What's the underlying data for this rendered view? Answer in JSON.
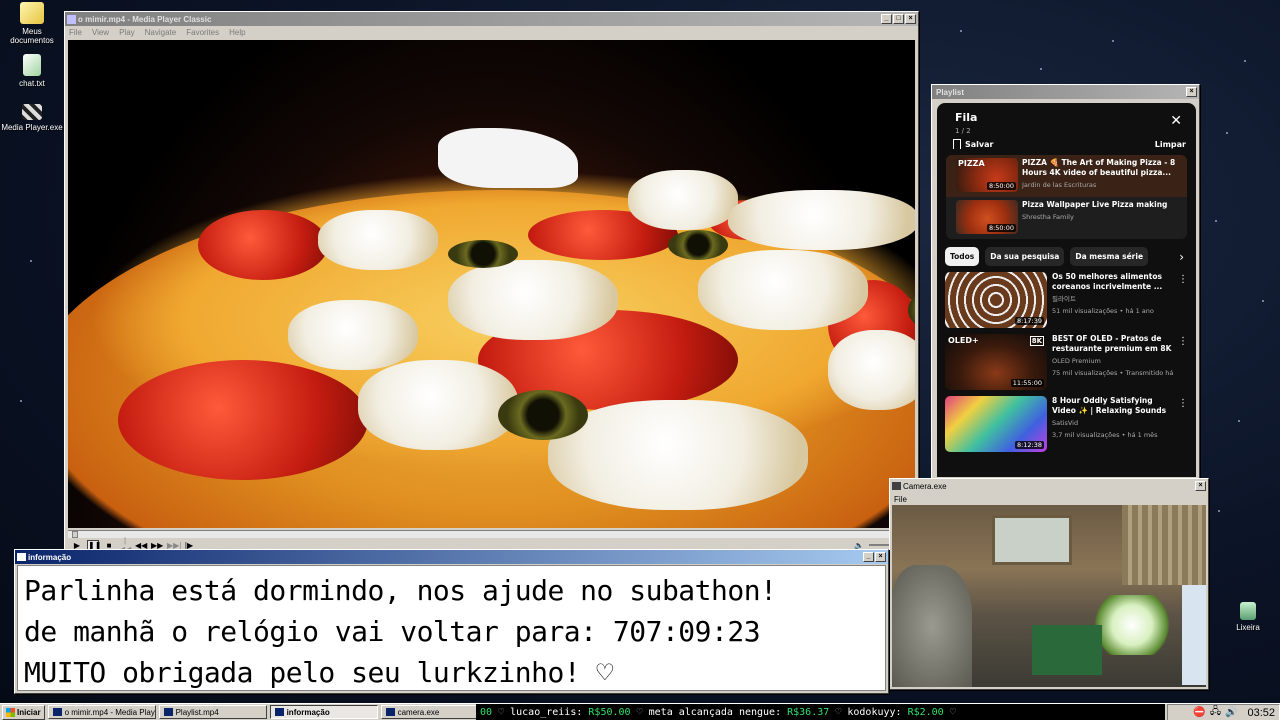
{
  "desktop": {
    "icons": [
      {
        "label": "Meus documentos"
      },
      {
        "label": "chat.txt"
      },
      {
        "label": "Media Player.exe"
      },
      {
        "label": "Lixeira"
      }
    ]
  },
  "mpc": {
    "title": "o mimir.mp4 - Media Player Classic",
    "menu": [
      "File",
      "View",
      "Play",
      "Navigate",
      "Favorites",
      "Help"
    ]
  },
  "playlist": {
    "title": "Playlist",
    "header": "Fila",
    "count": "1 / 2",
    "save_label": "Salvar",
    "clear_label": "Limpar",
    "queue": [
      {
        "title": "PIZZA 🍕 The Art of Making Pizza - 8 Hours 4K video of beautiful pizza...",
        "channel": "Jardin de las Escrituras",
        "duration": "8:50:00",
        "thumb_text": "PIZZA"
      },
      {
        "title": "Pizza Wallpaper Live Pizza making",
        "channel": "Shrestha Family",
        "duration": "8:50:00"
      }
    ],
    "chips": [
      "Todos",
      "Da sua pesquisa",
      "Da mesma série"
    ],
    "recommended": [
      {
        "title": "Os 50 melhores alimentos coreanos incrivelmente ...",
        "channel": "필라이트",
        "meta": "51 mil visualizações • há 1 ano",
        "duration": "8:17:39"
      },
      {
        "title": "BEST OF OLED - Pratos de restaurante premium em 8K ...",
        "channel": "OLED Premium",
        "meta": "75 mil visualizações • Transmitido há 1 ...",
        "duration": "11:55:00",
        "thumb_text": "OLED+",
        "badge": "8K"
      },
      {
        "title": "8 Hour Oddly Satisfying Video ✨ | Relaxing Sounds to Fall ...",
        "channel": "SatisVid",
        "meta": "3,7 mil visualizações • há 1 mês",
        "duration": "8:12:38"
      }
    ]
  },
  "camera": {
    "title": "Camera.exe",
    "menu": [
      "File"
    ]
  },
  "info": {
    "title": "informação",
    "lines": [
      "Parlinha está dormindo, nos ajude no subathon!",
      "de manhã o relógio vai voltar para:  707:09:23",
      "MUITO obrigada pelo seu lurkzinho! ♡"
    ]
  },
  "taskbar": {
    "start_label": "Iniciar",
    "tasks": [
      {
        "label": "o mimir.mp4 - Media Playe..."
      },
      {
        "label": "Playlist.mp4"
      },
      {
        "label": "informação",
        "active": true
      },
      {
        "label": "camera.exe"
      }
    ],
    "ticker": {
      "lead": "00",
      "entries": [
        {
          "user": "lucao_reiis:",
          "amount": "R$50.00"
        },
        {
          "user": "meta alcançada nengue:",
          "amount": "R$36.37"
        },
        {
          "user": "kodokuyy:",
          "amount": "R$2.00"
        }
      ]
    },
    "clock": "03:52"
  }
}
